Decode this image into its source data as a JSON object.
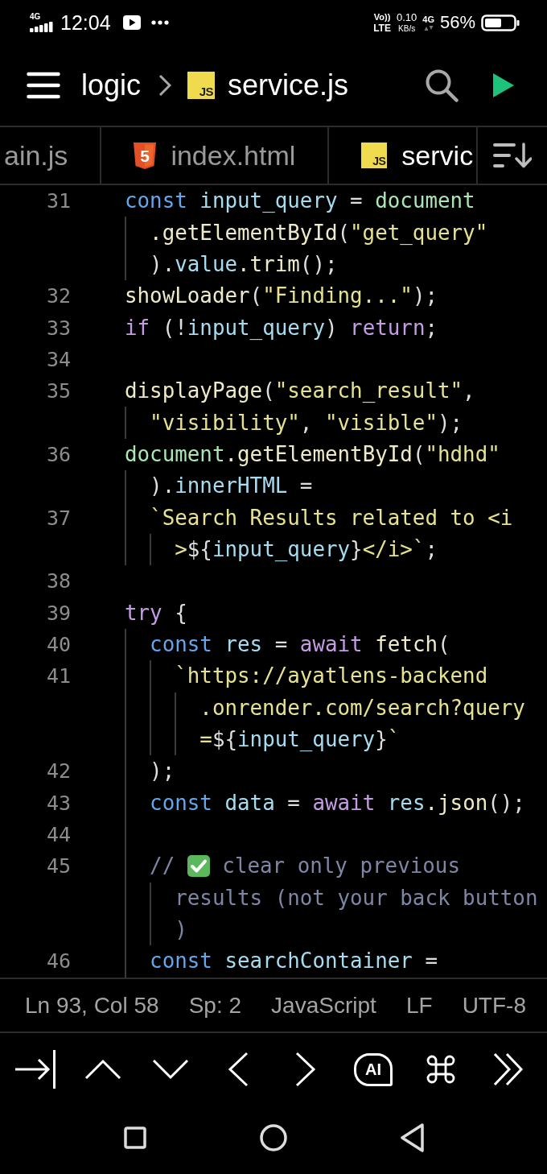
{
  "status_bar": {
    "network_small": "4G",
    "time": "12:04",
    "volte_top": "Vo))",
    "volte_bottom": "LTE",
    "speed_value": "0.10",
    "speed_unit": "KB/s",
    "data_type": "4G",
    "battery": "56%"
  },
  "header": {
    "folder": "logic",
    "file_badge": "JS",
    "file": "service.js"
  },
  "tabs": [
    {
      "label": "ain.js",
      "selected": false
    },
    {
      "label": "index.html",
      "kind": "html",
      "badge": "5",
      "selected": false
    },
    {
      "label": "servic",
      "kind": "js",
      "badge": "JS",
      "selected": true
    }
  ],
  "code": {
    "rows": [
      {
        "number": "31",
        "tokens": [
          {
            "kind": "keyword",
            "text": "const "
          },
          {
            "kind": "variable",
            "text": "input_query"
          },
          {
            "kind": "punctuation",
            "text": " = "
          },
          {
            "kind": "global",
            "text": "document"
          }
        ]
      },
      {
        "indent": "  ",
        "tokens": [
          {
            "kind": "function",
            "text": ".getElementById"
          },
          {
            "kind": "punctuation",
            "text": "("
          },
          {
            "kind": "string",
            "text": "\"get_query\""
          }
        ]
      },
      {
        "indent": "  ",
        "tokens": [
          {
            "kind": "punctuation",
            "text": ")."
          },
          {
            "kind": "variable",
            "text": "value"
          },
          {
            "kind": "function",
            "text": ".trim"
          },
          {
            "kind": "punctuation",
            "text": "();"
          }
        ]
      },
      {
        "number": "32",
        "tokens": [
          {
            "kind": "function",
            "text": "showLoader"
          },
          {
            "kind": "punctuation",
            "text": "("
          },
          {
            "kind": "string",
            "text": "\"Finding...\""
          },
          {
            "kind": "punctuation",
            "text": ");"
          }
        ]
      },
      {
        "number": "33",
        "tokens": [
          {
            "kind": "control",
            "text": "if"
          },
          {
            "kind": "punctuation",
            "text": " (!"
          },
          {
            "kind": "variable",
            "text": "input_query"
          },
          {
            "kind": "punctuation",
            "text": ") "
          },
          {
            "kind": "control",
            "text": "return"
          },
          {
            "kind": "punctuation",
            "text": ";"
          }
        ]
      },
      {
        "number": "34"
      },
      {
        "number": "35",
        "tokens": [
          {
            "kind": "function",
            "text": "displayPage"
          },
          {
            "kind": "punctuation",
            "text": "("
          },
          {
            "kind": "string",
            "text": "\"search_result\""
          },
          {
            "kind": "punctuation",
            "text": ","
          }
        ]
      },
      {
        "indent": "  ",
        "tokens": [
          {
            "kind": "string",
            "text": "\"visibility\""
          },
          {
            "kind": "punctuation",
            "text": ", "
          },
          {
            "kind": "string",
            "text": "\"visible\""
          },
          {
            "kind": "punctuation",
            "text": ");"
          }
        ]
      },
      {
        "number": "36",
        "tokens": [
          {
            "kind": "global",
            "text": "document"
          },
          {
            "kind": "function",
            "text": ".getElementById"
          },
          {
            "kind": "punctuation",
            "text": "("
          },
          {
            "kind": "string",
            "text": "\"hdhd\""
          }
        ]
      },
      {
        "indent": "  ",
        "tokens": [
          {
            "kind": "punctuation",
            "text": ")."
          },
          {
            "kind": "variable",
            "text": "innerHTML"
          },
          {
            "kind": "punctuation",
            "text": " ="
          }
        ]
      },
      {
        "number": "37",
        "indent": "  ",
        "tokens": [
          {
            "kind": "string",
            "text": "`Search Results related to <i"
          }
        ]
      },
      {
        "indent": "    ",
        "tokens": [
          {
            "kind": "string",
            "text": ">"
          },
          {
            "kind": "punctuation",
            "text": "${"
          },
          {
            "kind": "variable",
            "text": "input_query"
          },
          {
            "kind": "punctuation",
            "text": "}"
          },
          {
            "kind": "string",
            "text": "</i>`"
          },
          {
            "kind": "punctuation",
            "text": ";"
          }
        ]
      },
      {
        "number": "38"
      },
      {
        "number": "39",
        "tokens": [
          {
            "kind": "control",
            "text": "try"
          },
          {
            "kind": "punctuation",
            "text": " {"
          }
        ]
      },
      {
        "number": "40",
        "indent": "  ",
        "tokens": [
          {
            "kind": "keyword",
            "text": "const "
          },
          {
            "kind": "variable",
            "text": "res"
          },
          {
            "kind": "punctuation",
            "text": " = "
          },
          {
            "kind": "control",
            "text": "await "
          },
          {
            "kind": "function",
            "text": "fetch"
          },
          {
            "kind": "punctuation",
            "text": "("
          }
        ]
      },
      {
        "number": "41",
        "indent": "    ",
        "tokens": [
          {
            "kind": "string",
            "text": "`https://ayatlens-backend"
          }
        ]
      },
      {
        "indent": "      ",
        "tokens": [
          {
            "kind": "string",
            "text": ".onrender.com/search?query"
          }
        ]
      },
      {
        "indent": "      ",
        "tokens": [
          {
            "kind": "string",
            "text": "="
          },
          {
            "kind": "punctuation",
            "text": "${"
          },
          {
            "kind": "variable",
            "text": "input_query"
          },
          {
            "kind": "punctuation",
            "text": "}"
          },
          {
            "kind": "string",
            "text": "`"
          }
        ]
      },
      {
        "number": "42",
        "indent": "  ",
        "tokens": [
          {
            "kind": "punctuation",
            "text": ");"
          }
        ]
      },
      {
        "number": "43",
        "indent": "  ",
        "tokens": [
          {
            "kind": "keyword",
            "text": "const "
          },
          {
            "kind": "variable",
            "text": "data"
          },
          {
            "kind": "punctuation",
            "text": " = "
          },
          {
            "kind": "control",
            "text": "await "
          },
          {
            "kind": "variable",
            "text": "res"
          },
          {
            "kind": "function",
            "text": ".json"
          },
          {
            "kind": "punctuation",
            "text": "();"
          }
        ]
      },
      {
        "number": "44",
        "indent": "  "
      },
      {
        "number": "45",
        "indent": "  ",
        "tokens": [
          {
            "kind": "comment",
            "text": "//"
          },
          {
            "kind": "emoji"
          },
          {
            "kind": "comment",
            "text": "clear only previous"
          }
        ]
      },
      {
        "indent": "    ",
        "tokens": [
          {
            "kind": "comment",
            "text": "results (not your back button"
          }
        ]
      },
      {
        "indent": "    ",
        "tokens": [
          {
            "kind": "comment",
            "text": ")"
          }
        ]
      },
      {
        "number": "46",
        "indent": "  ",
        "tokens": [
          {
            "kind": "keyword",
            "text": "const "
          },
          {
            "kind": "variable",
            "text": "searchContainer"
          },
          {
            "kind": "punctuation",
            "text": " ="
          }
        ]
      }
    ]
  },
  "editor_status": {
    "cursor": "Ln 93, Col 58",
    "indentation": "Sp: 2",
    "language": "JavaScript",
    "line_ending": "LF",
    "encoding": "UTF-8"
  },
  "keyboard_toolbar": {
    "ai_label": "AI"
  }
}
